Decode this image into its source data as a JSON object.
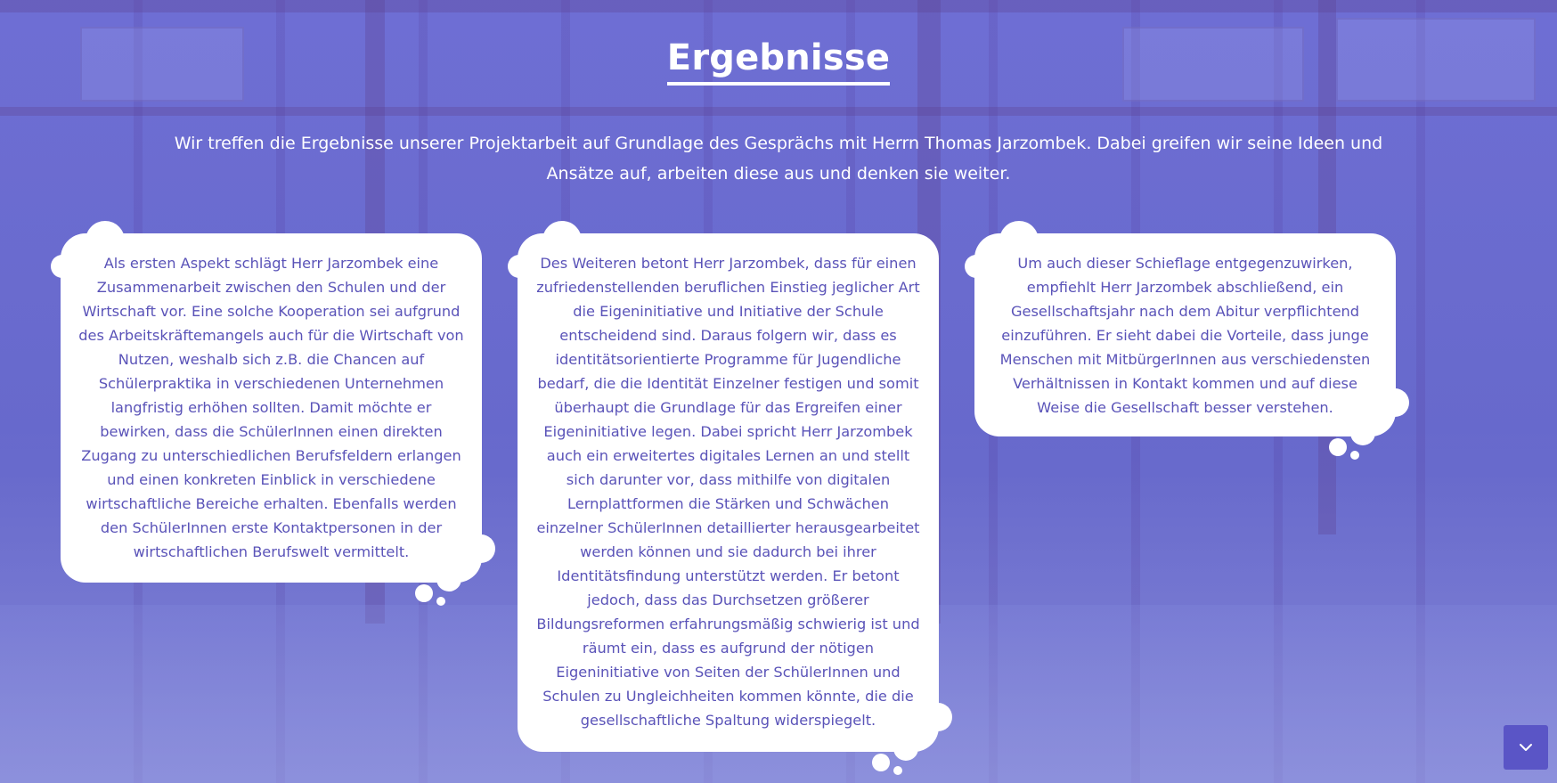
{
  "section": {
    "title": "Ergebnisse",
    "intro": "Wir treffen die Ergebnisse unserer Projektarbeit auf Grundlage des Gesprächs mit Herrn Thomas Jarzombek. Dabei greifen wir seine Ideen und Ansätze auf, arbeiten diese aus und denken sie weiter."
  },
  "bubbles": [
    {
      "text": "Als ersten Aspekt schlägt Herr Jarzombek eine Zusammenarbeit zwischen den Schulen und der Wirtschaft vor. Eine solche Kooperation sei aufgrund des Arbeitskräftemangels auch für die Wirtschaft von Nutzen, weshalb sich z.B. die Chancen auf Schülerpraktika in verschiedenen Unternehmen langfristig erhöhen sollten. Damit möchte er bewirken, dass die SchülerInnen einen direkten Zugang zu unterschiedlichen Berufsfeldern erlangen und einen konkreten Einblick in verschiedene wirtschaftliche Bereiche erhalten. Ebenfalls werden den SchülerInnen erste Kontaktpersonen in der wirtschaftlichen Berufswelt vermittelt."
    },
    {
      "text": "Des Weiteren betont Herr Jarzombek, dass für einen zufriedenstellenden beruflichen Einstieg jeglicher Art die Eigeninitiative und Initiative der Schule entscheidend sind. Daraus folgern wir, dass es identitätsorientierte Programme für Jugendliche bedarf, die die Identität Einzelner festigen und somit überhaupt die Grundlage für das Ergreifen einer Eigeninitiative legen. Dabei spricht Herr Jarzombek auch ein erweitertes digitales Lernen an und stellt sich darunter vor, dass mithilfe von digitalen Lernplattformen die Stärken und Schwächen einzelner SchülerInnen detaillierter herausgearbeitet werden können und sie dadurch bei ihrer Identitätsfindung unterstützt werden. Er betont jedoch, dass das Durchsetzen größerer Bildungsreformen erfahrungsmäßig schwierig ist und räumt ein, dass es aufgrund der nötigen Eigeninitiative von Seiten der SchülerInnen und Schulen zu Ungleichheiten kommen könnte, die die gesellschaftliche Spaltung widerspiegelt."
    },
    {
      "text": "Um auch dieser Schieflage entgegenzuwirken, empfiehlt Herr Jarzombek abschließend, ein Gesellschaftsjahr nach dem Abitur verpflichtend einzuführen. Er sieht dabei die Vorteile, dass junge Menschen mit MitbürgerInnen aus verschiedensten Verhältnissen in Kontakt kommen und auf diese Weise die Gesellschaft besser verstehen."
    }
  ],
  "scroll_button": {
    "icon": "chevron-down-icon"
  },
  "colors": {
    "background": "#7274cf",
    "bubble_text": "#5a53b8",
    "bubble_bg": "#ffffff",
    "button_bg": "#5a55c6"
  }
}
